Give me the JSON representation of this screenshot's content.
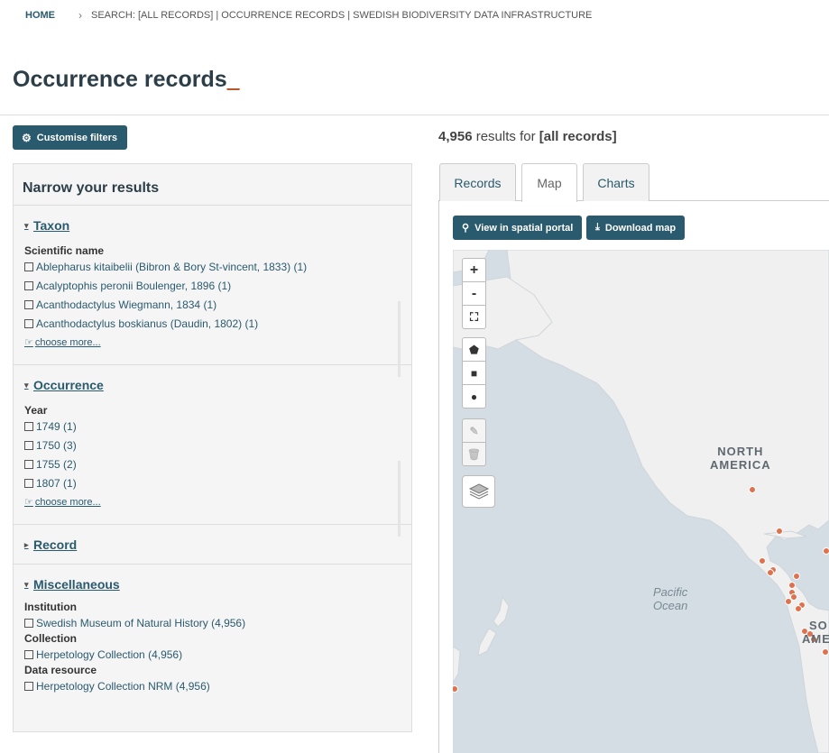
{
  "breadcrumb": {
    "home": "HOME",
    "current": "SEARCH: [ALL RECORDS] | OCCURRENCE RECORDS | SWEDISH BIODIVERSITY DATA INFRASTRUCTURE"
  },
  "page": {
    "title": "Occurrence records",
    "title_suffix": "_"
  },
  "customise_button": "Customise filters",
  "facets": {
    "heading": "Narrow your results",
    "taxon": {
      "title": "Taxon",
      "sub_label": "Scientific name",
      "items": [
        "Ablepharus kitaibelii (Bibron & Bory St-vincent, 1833) (1)",
        "Acalyptophis peronii Boulenger, 1896 (1)",
        "Acanthodactylus Wiegmann, 1834 (1)",
        "Acanthodactylus boskianus (Daudin, 1802) (1)"
      ],
      "more": "choose more..."
    },
    "occurrence": {
      "title": "Occurrence",
      "sub_label": "Year",
      "items": [
        "1749 (1)",
        "1750 (3)",
        "1755 (2)",
        "1807 (1)"
      ],
      "more": "choose more..."
    },
    "record": {
      "title": "Record"
    },
    "miscellaneous": {
      "title": "Miscellaneous",
      "groups": [
        {
          "label": "Institution",
          "item": "Swedish Museum of Natural History (4,956)"
        },
        {
          "label": "Collection",
          "item": "Herpetology Collection (4,956)"
        },
        {
          "label": "Data resource",
          "item": "Herpetology Collection NRM (4,956)"
        }
      ]
    }
  },
  "results": {
    "count": "4,956",
    "text": "results for",
    "query": "[all records]"
  },
  "tabs": [
    "Records",
    "Map",
    "Charts"
  ],
  "active_tab": "Map",
  "map_buttons": {
    "spatial": "View in spatial portal",
    "download": "Download map"
  },
  "map_controls": {
    "zoom_in": "+",
    "zoom_out": "-"
  },
  "map_labels": {
    "north_america": [
      "NORTH",
      "AMERICA"
    ],
    "pacific": [
      "Pacific",
      "Ocean"
    ],
    "south_america": [
      "SO",
      "AME"
    ]
  },
  "colors": {
    "accent": "#2a5a6e",
    "marker": "#e0714e",
    "land": "#f0f0f0",
    "water": "#d4dde4"
  }
}
